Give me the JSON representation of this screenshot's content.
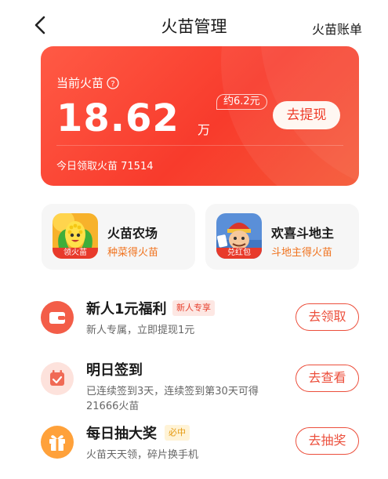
{
  "nav": {
    "title": "火苗管理",
    "right_link": "火苗账单"
  },
  "balance": {
    "label": "当前火苗",
    "amount": "18.62",
    "unit": "万",
    "approx": "约6.2元",
    "withdraw_label": "去提现",
    "today_text": "今日领取火苗 71514"
  },
  "games": [
    {
      "name": "火苗农场",
      "subtitle": "种菜得火苗",
      "badge": "领火苗",
      "icon": "corn-mascot-icon"
    },
    {
      "name": "欢喜斗地主",
      "subtitle": "斗地主得火苗",
      "badge": "兑红包",
      "icon": "landlord-mascot-icon"
    }
  ],
  "tasks": [
    {
      "title": "新人1元福利",
      "tag": "新人专享",
      "desc": "新人专属，立即提现1元",
      "button": "去领取",
      "icon": "wallet-icon"
    },
    {
      "title": "明日签到",
      "tag": "",
      "desc": "已连续签到3天，连续签到第30天可得21666火苗",
      "button": "去查看",
      "icon": "calendar-check-icon"
    },
    {
      "title": "每日抽大奖",
      "tag": "必中",
      "desc": "火苗天天领，碎片换手机",
      "button": "去抽奖",
      "icon": "gift-icon"
    }
  ],
  "colors": {
    "accent": "#ef4a37",
    "card_start": "#ff5a45",
    "card_end": "#f55735",
    "subtitle_orange": "#f0731f"
  }
}
